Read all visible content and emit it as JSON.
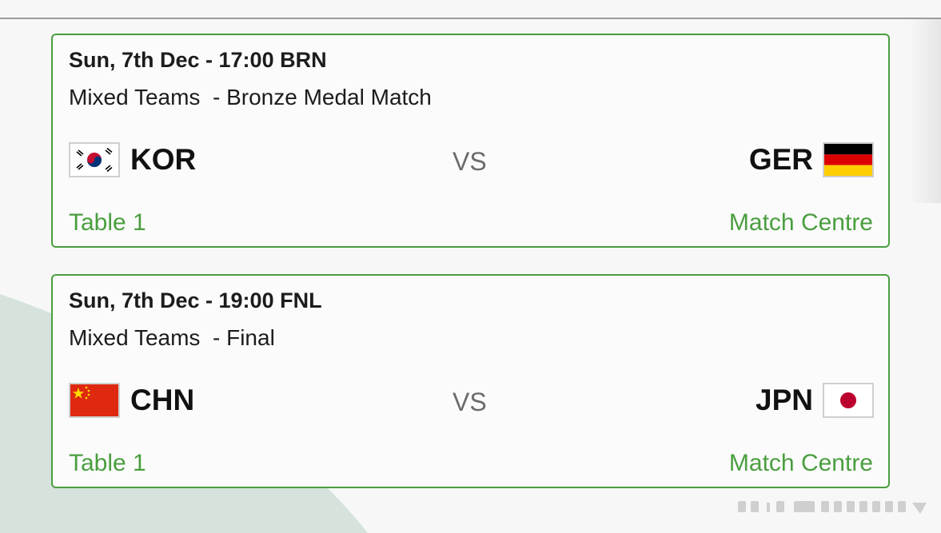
{
  "matches": [
    {
      "datetime": "Sun, 7th Dec - 17:00 BRN",
      "event": "Mixed Teams  - Bronze Medal Match",
      "home": {
        "code": "KOR",
        "flag": "south-korea-flag"
      },
      "vs": "VS",
      "away": {
        "code": "GER",
        "flag": "germany-flag"
      },
      "table": "Table 1",
      "link": "Match Centre"
    },
    {
      "datetime": "Sun, 7th Dec - 19:00 FNL",
      "event": "Mixed Teams  - Final",
      "home": {
        "code": "CHN",
        "flag": "china-flag"
      },
      "vs": "VS",
      "away": {
        "code": "JPN",
        "flag": "japan-flag"
      },
      "table": "Table 1",
      "link": "Match Centre"
    }
  ],
  "colors": {
    "accent": "#4a9e3f",
    "card_background": "#fbfbfb",
    "page_background": "#f7f7f7",
    "wedge": "#d5e3dc"
  }
}
